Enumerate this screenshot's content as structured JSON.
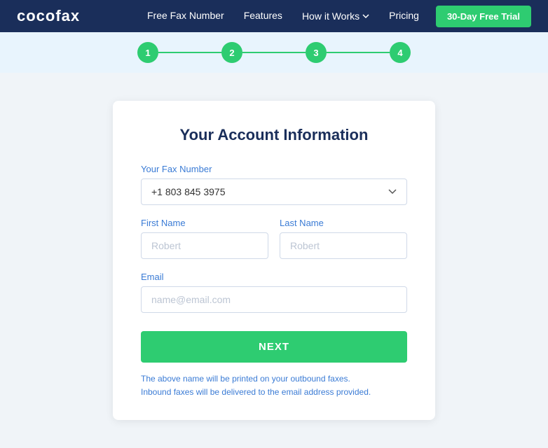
{
  "navbar": {
    "logo_text": "cocofax",
    "links": [
      {
        "label": "Free Fax Number",
        "name": "free-fax-number"
      },
      {
        "label": "Features",
        "name": "features"
      },
      {
        "label": "How it Works",
        "name": "how-it-works",
        "has_dropdown": true
      },
      {
        "label": "Pricing",
        "name": "pricing"
      }
    ],
    "trial_button": "30-Day Free Trial"
  },
  "steps": [
    {
      "number": "1"
    },
    {
      "number": "2"
    },
    {
      "number": "3"
    },
    {
      "number": "4"
    }
  ],
  "form": {
    "title": "Your Account Information",
    "fax_label": "Your Fax Number",
    "fax_value": "+1 803 845 3975",
    "first_name_label": "First Name",
    "first_name_placeholder": "Robert",
    "last_name_label": "Last Name",
    "last_name_placeholder": "Robert",
    "email_label": "Email",
    "email_placeholder": "name@email.com",
    "next_button": "NEXT",
    "note_line1": "The above name will be printed on your outbound faxes.",
    "note_line2": "Inbound faxes will be delivered to the email address provided."
  }
}
